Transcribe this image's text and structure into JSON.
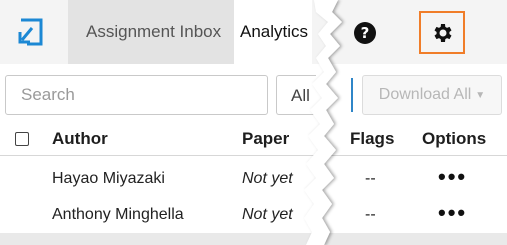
{
  "nav": {
    "logo_icon": "turnitin-logo-icon",
    "tabs": [
      {
        "label": "Assignment Inbox"
      },
      {
        "label": "Analytics"
      }
    ],
    "help_icon": "help-icon",
    "settings_icon": "gear-icon",
    "settings_highlight_color": "#f07d29"
  },
  "toolbar": {
    "search_placeholder": "Search",
    "filter_label": "All",
    "download_label": "Download All",
    "download_icon": "caret-down-icon"
  },
  "table": {
    "columns": [
      "Author",
      "Paper",
      "Flags",
      "Options"
    ],
    "rows": [
      {
        "author": "Hayao Miyazaki",
        "paper": "Not yet",
        "flags": "--",
        "options": "•••"
      },
      {
        "author": "Anthony Minghella",
        "paper": "Not yet",
        "flags": "--",
        "options": "•••"
      }
    ]
  }
}
